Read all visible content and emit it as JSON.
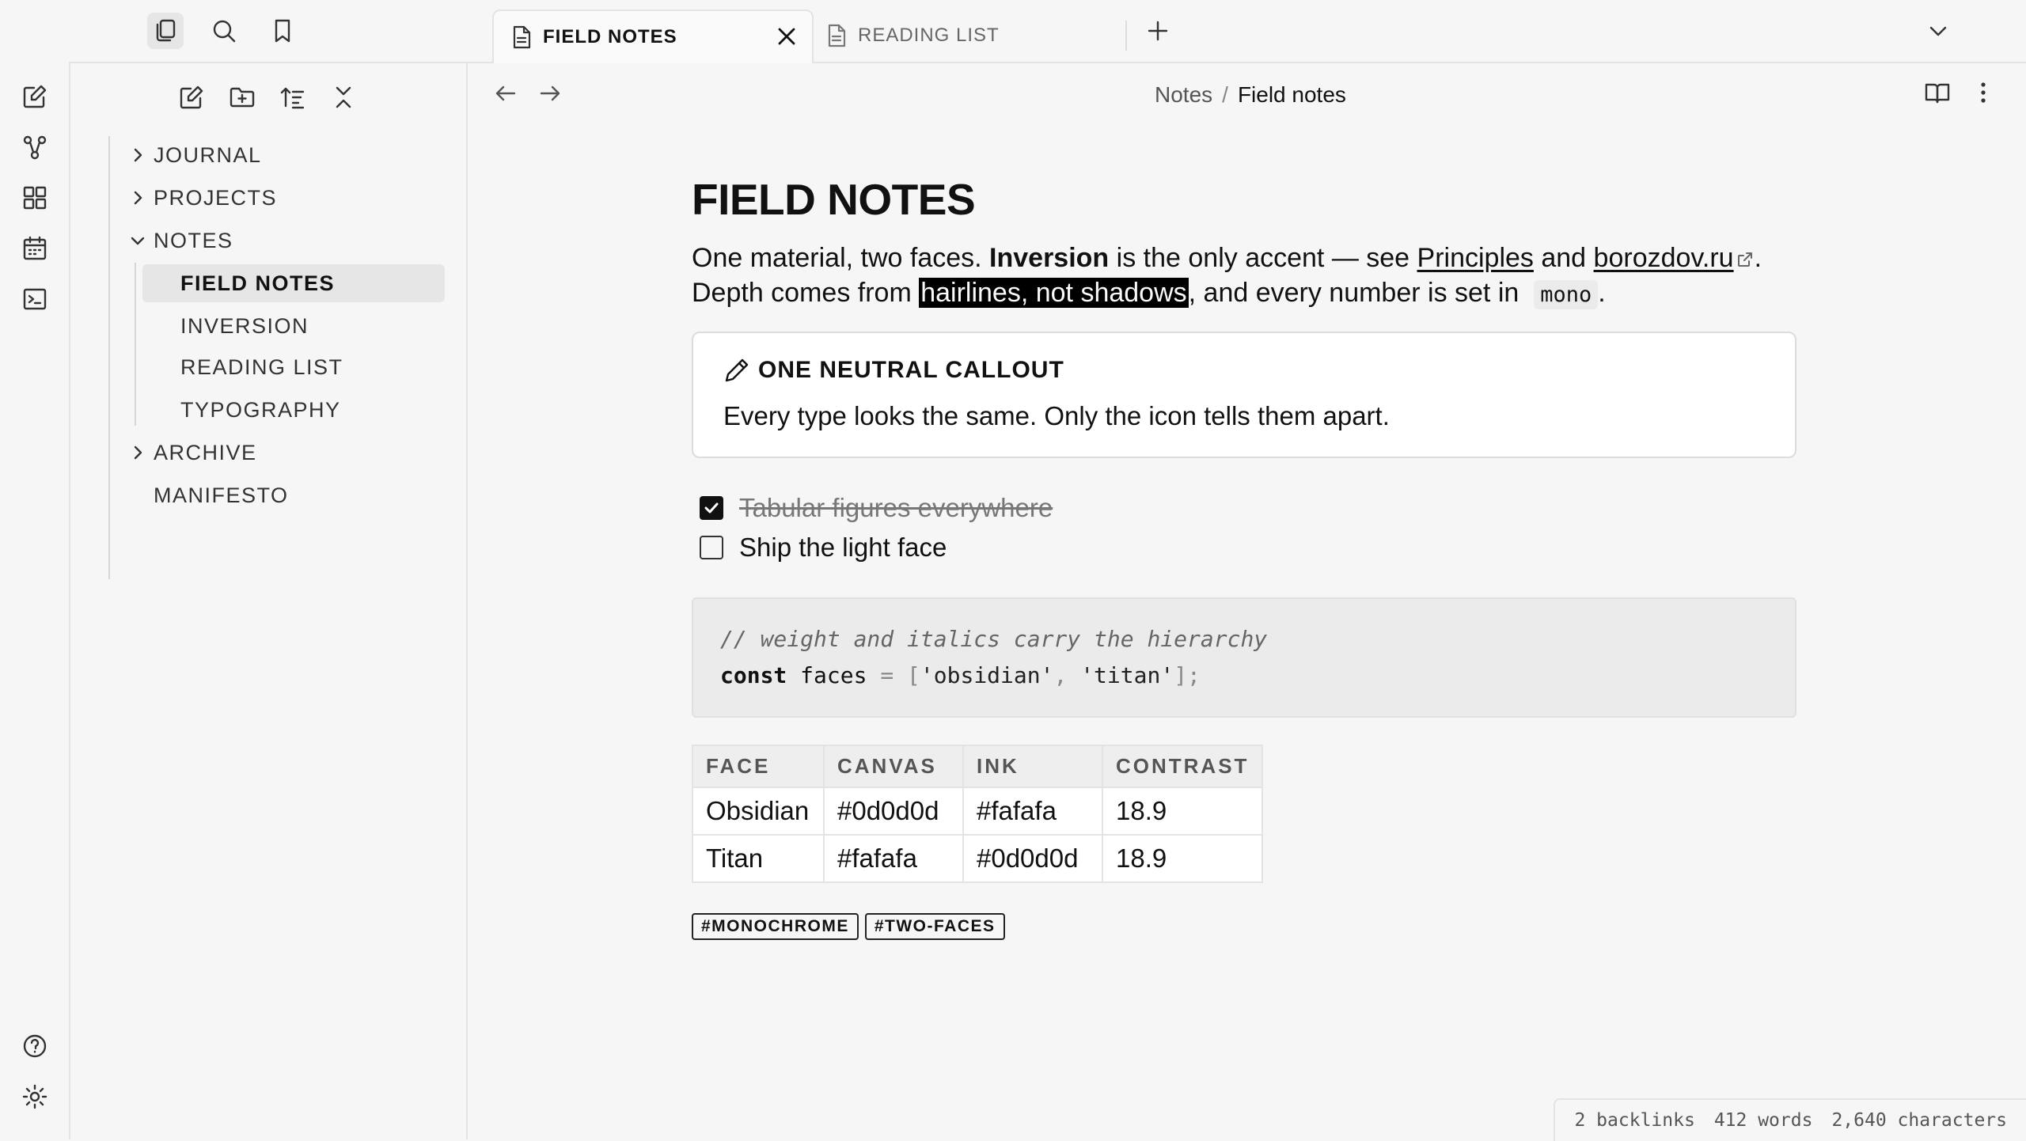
{
  "tabs": [
    {
      "label": "FIELD NOTES",
      "active": true
    },
    {
      "label": "READING LIST",
      "active": false
    }
  ],
  "breadcrumb": {
    "parent": "Notes",
    "separator": "/",
    "current": "Field notes"
  },
  "explorer": {
    "items": [
      {
        "label": "JOURNAL",
        "type": "folder",
        "expanded": false
      },
      {
        "label": "PROJECTS",
        "type": "folder",
        "expanded": false
      },
      {
        "label": "NOTES",
        "type": "folder",
        "expanded": true
      },
      {
        "label": "FIELD NOTES",
        "type": "file",
        "selected": true
      },
      {
        "label": "INVERSION",
        "type": "file"
      },
      {
        "label": "READING LIST",
        "type": "file"
      },
      {
        "label": "TYPOGRAPHY",
        "type": "file"
      },
      {
        "label": "ARCHIVE",
        "type": "folder",
        "expanded": false
      },
      {
        "label": "MANIFESTO",
        "type": "file"
      }
    ]
  },
  "note": {
    "title": "FIELD NOTES",
    "p1": {
      "t1": "One material, two faces. ",
      "bold": "Inversion",
      "t2": " is the only accent — see ",
      "link1": "Principles",
      "t3": " and ",
      "link2": "borozdov.ru",
      "t4": ".",
      "t5": "Depth comes from ",
      "highlight": "hairlines, not shadows",
      "t6": ", and every number is set in ",
      "code": "mono",
      "t7": "."
    },
    "callout": {
      "title": "ONE NEUTRAL CALLOUT",
      "body": "Every type looks the same. Only the icon tells them apart."
    },
    "tasks": [
      {
        "label": "Tabular figures everywhere",
        "checked": true
      },
      {
        "label": "Ship the light face",
        "checked": false
      }
    ],
    "code": {
      "comment": "// weight and italics carry the hierarchy",
      "keyword": "const",
      "ident": "faces",
      "eq": "=",
      "open": "[",
      "s1": "'obsidian'",
      "comma": ",",
      "s2": "'titan'",
      "close": "];"
    },
    "table": {
      "headers": [
        "FACE",
        "CANVAS",
        "INK",
        "CONTRAST"
      ],
      "rows": [
        [
          "Obsidian",
          "#0d0d0d",
          "#fafafa",
          "18.9"
        ],
        [
          "Titan",
          "#fafafa",
          "#0d0d0d",
          "18.9"
        ]
      ]
    },
    "tags": [
      "#MONOCHROME",
      "#TWO-FACES"
    ]
  },
  "status": {
    "backlinks": "2 backlinks",
    "words": "412 words",
    "characters": "2,640 characters"
  },
  "colors": {
    "canvas": "#f6f6f6",
    "ink": "#111111",
    "highlight": "#000000"
  }
}
